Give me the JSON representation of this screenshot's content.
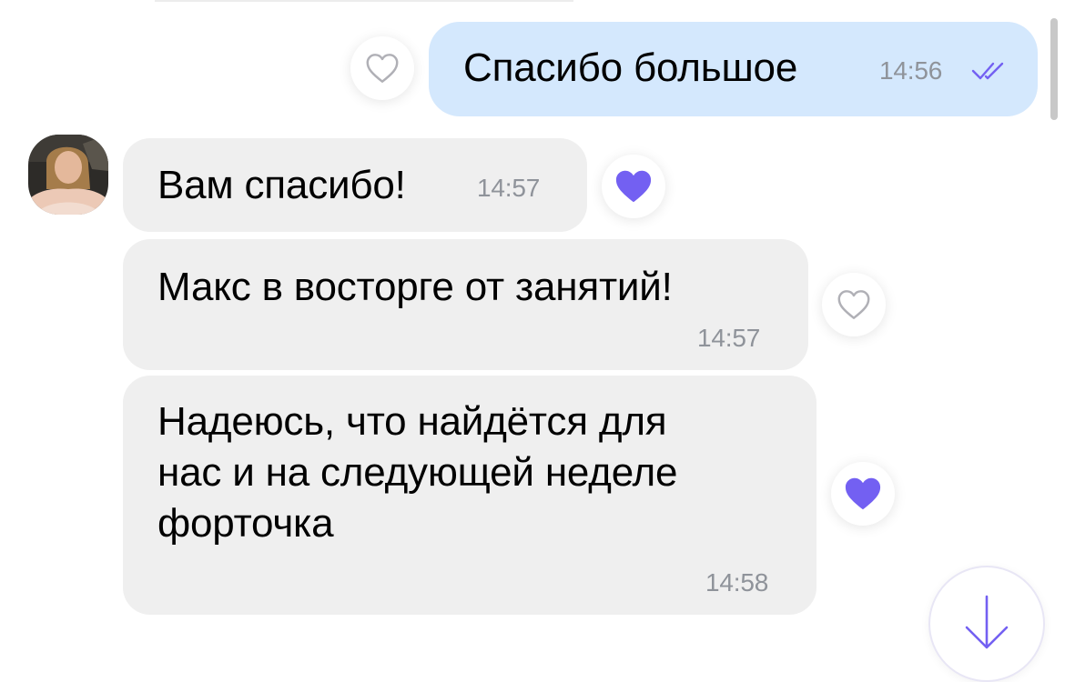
{
  "colors": {
    "outgoing_bubble": "#d4e8fd",
    "incoming_bubble": "#efefef",
    "accent": "#7360f2",
    "timestamp": "#8f939a"
  },
  "messages": [
    {
      "direction": "outgoing",
      "text": "Спасибо большое",
      "time": "14:56",
      "status_icon": "double-check-icon",
      "reaction": "heart-outline-icon"
    },
    {
      "direction": "incoming",
      "text": "Вам спасибо!",
      "time": "14:57",
      "reaction": "heart-filled-icon"
    },
    {
      "direction": "incoming",
      "text": "Макс в восторге от занятий!",
      "time": "14:57",
      "reaction": "heart-outline-icon"
    },
    {
      "direction": "incoming",
      "lines": [
        "Надеюсь, что найдётся для",
        "нас и на следующей неделе",
        "форточка"
      ],
      "time": "14:58",
      "reaction": "heart-filled-icon"
    }
  ],
  "controls": {
    "scroll_down_icon": "arrow-down-icon"
  }
}
